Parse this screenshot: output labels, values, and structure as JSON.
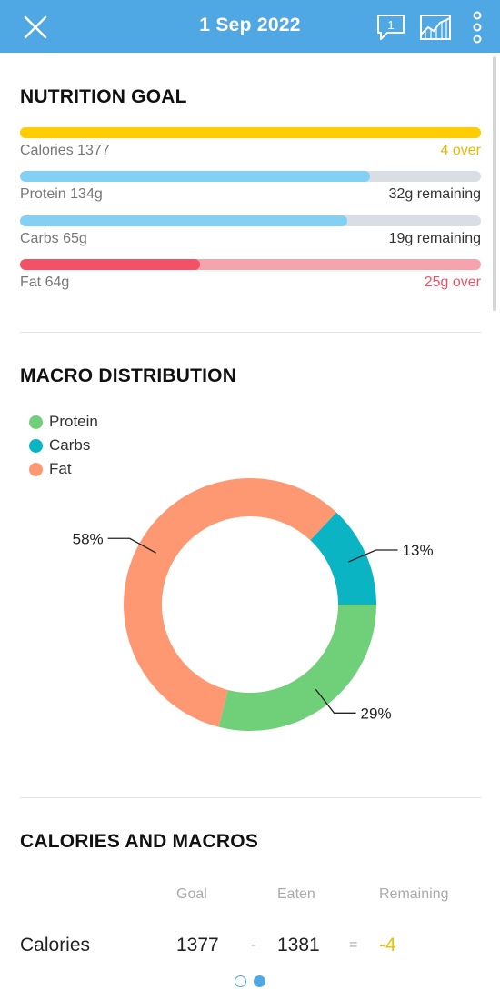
{
  "header": {
    "date": "1 Sep 2022",
    "comment_count": "1",
    "icons": [
      "close-icon",
      "comment-icon",
      "chart-icon",
      "more-icon"
    ]
  },
  "nutrition_goal": {
    "title": "NUTRITION GOAL",
    "rows": [
      {
        "label": "Calories 1377",
        "status": "4 over",
        "fill_fraction": 1.0,
        "fill_color": "#ffcc00",
        "track_color": "#ffcc00",
        "status_color": "#e8b800"
      },
      {
        "label": "Protein 134g",
        "status": "32g remaining",
        "fill_fraction": 0.76,
        "fill_color": "#82d0f4",
        "track_color": "#d9dee5",
        "status_color": "#333333"
      },
      {
        "label": "Carbs 65g",
        "status": "19g remaining",
        "fill_fraction": 0.71,
        "fill_color": "#82d0f4",
        "track_color": "#d9dee5",
        "status_color": "#333333"
      },
      {
        "label": "Fat 64g",
        "status": "25g over",
        "fill_fraction": 0.39,
        "fill_color": "#f25166",
        "track_color": "#f7a3ad",
        "status_color": "#f25166"
      }
    ]
  },
  "macro_distribution": {
    "title": "MACRO DISTRIBUTION",
    "legend": [
      {
        "label": "Protein",
        "color": "#70d07a"
      },
      {
        "label": "Carbs",
        "color": "#0bb4c3"
      },
      {
        "label": "Fat",
        "color": "#fd9872"
      }
    ],
    "slice_labels": {
      "carbs": "13%",
      "protein": "29%",
      "fat": "58%"
    }
  },
  "chart_data": {
    "type": "pie",
    "categories": [
      "Protein",
      "Carbs",
      "Fat"
    ],
    "values": [
      29,
      13,
      58
    ],
    "colors": [
      "#70d07a",
      "#0bb4c3",
      "#fd9872"
    ],
    "legend_position": "top-left"
  },
  "calories_and_macros": {
    "title": "CALORIES AND MACROS",
    "columns": [
      "Goal",
      "Eaten",
      "Remaining"
    ],
    "row": {
      "label": "Calories",
      "goal": "1377",
      "minus": "-",
      "eaten": "1381",
      "equals": "=",
      "remaining": "-4",
      "remaining_color": "#f0c000"
    }
  },
  "pager": {
    "pages": 2,
    "active": 2
  }
}
